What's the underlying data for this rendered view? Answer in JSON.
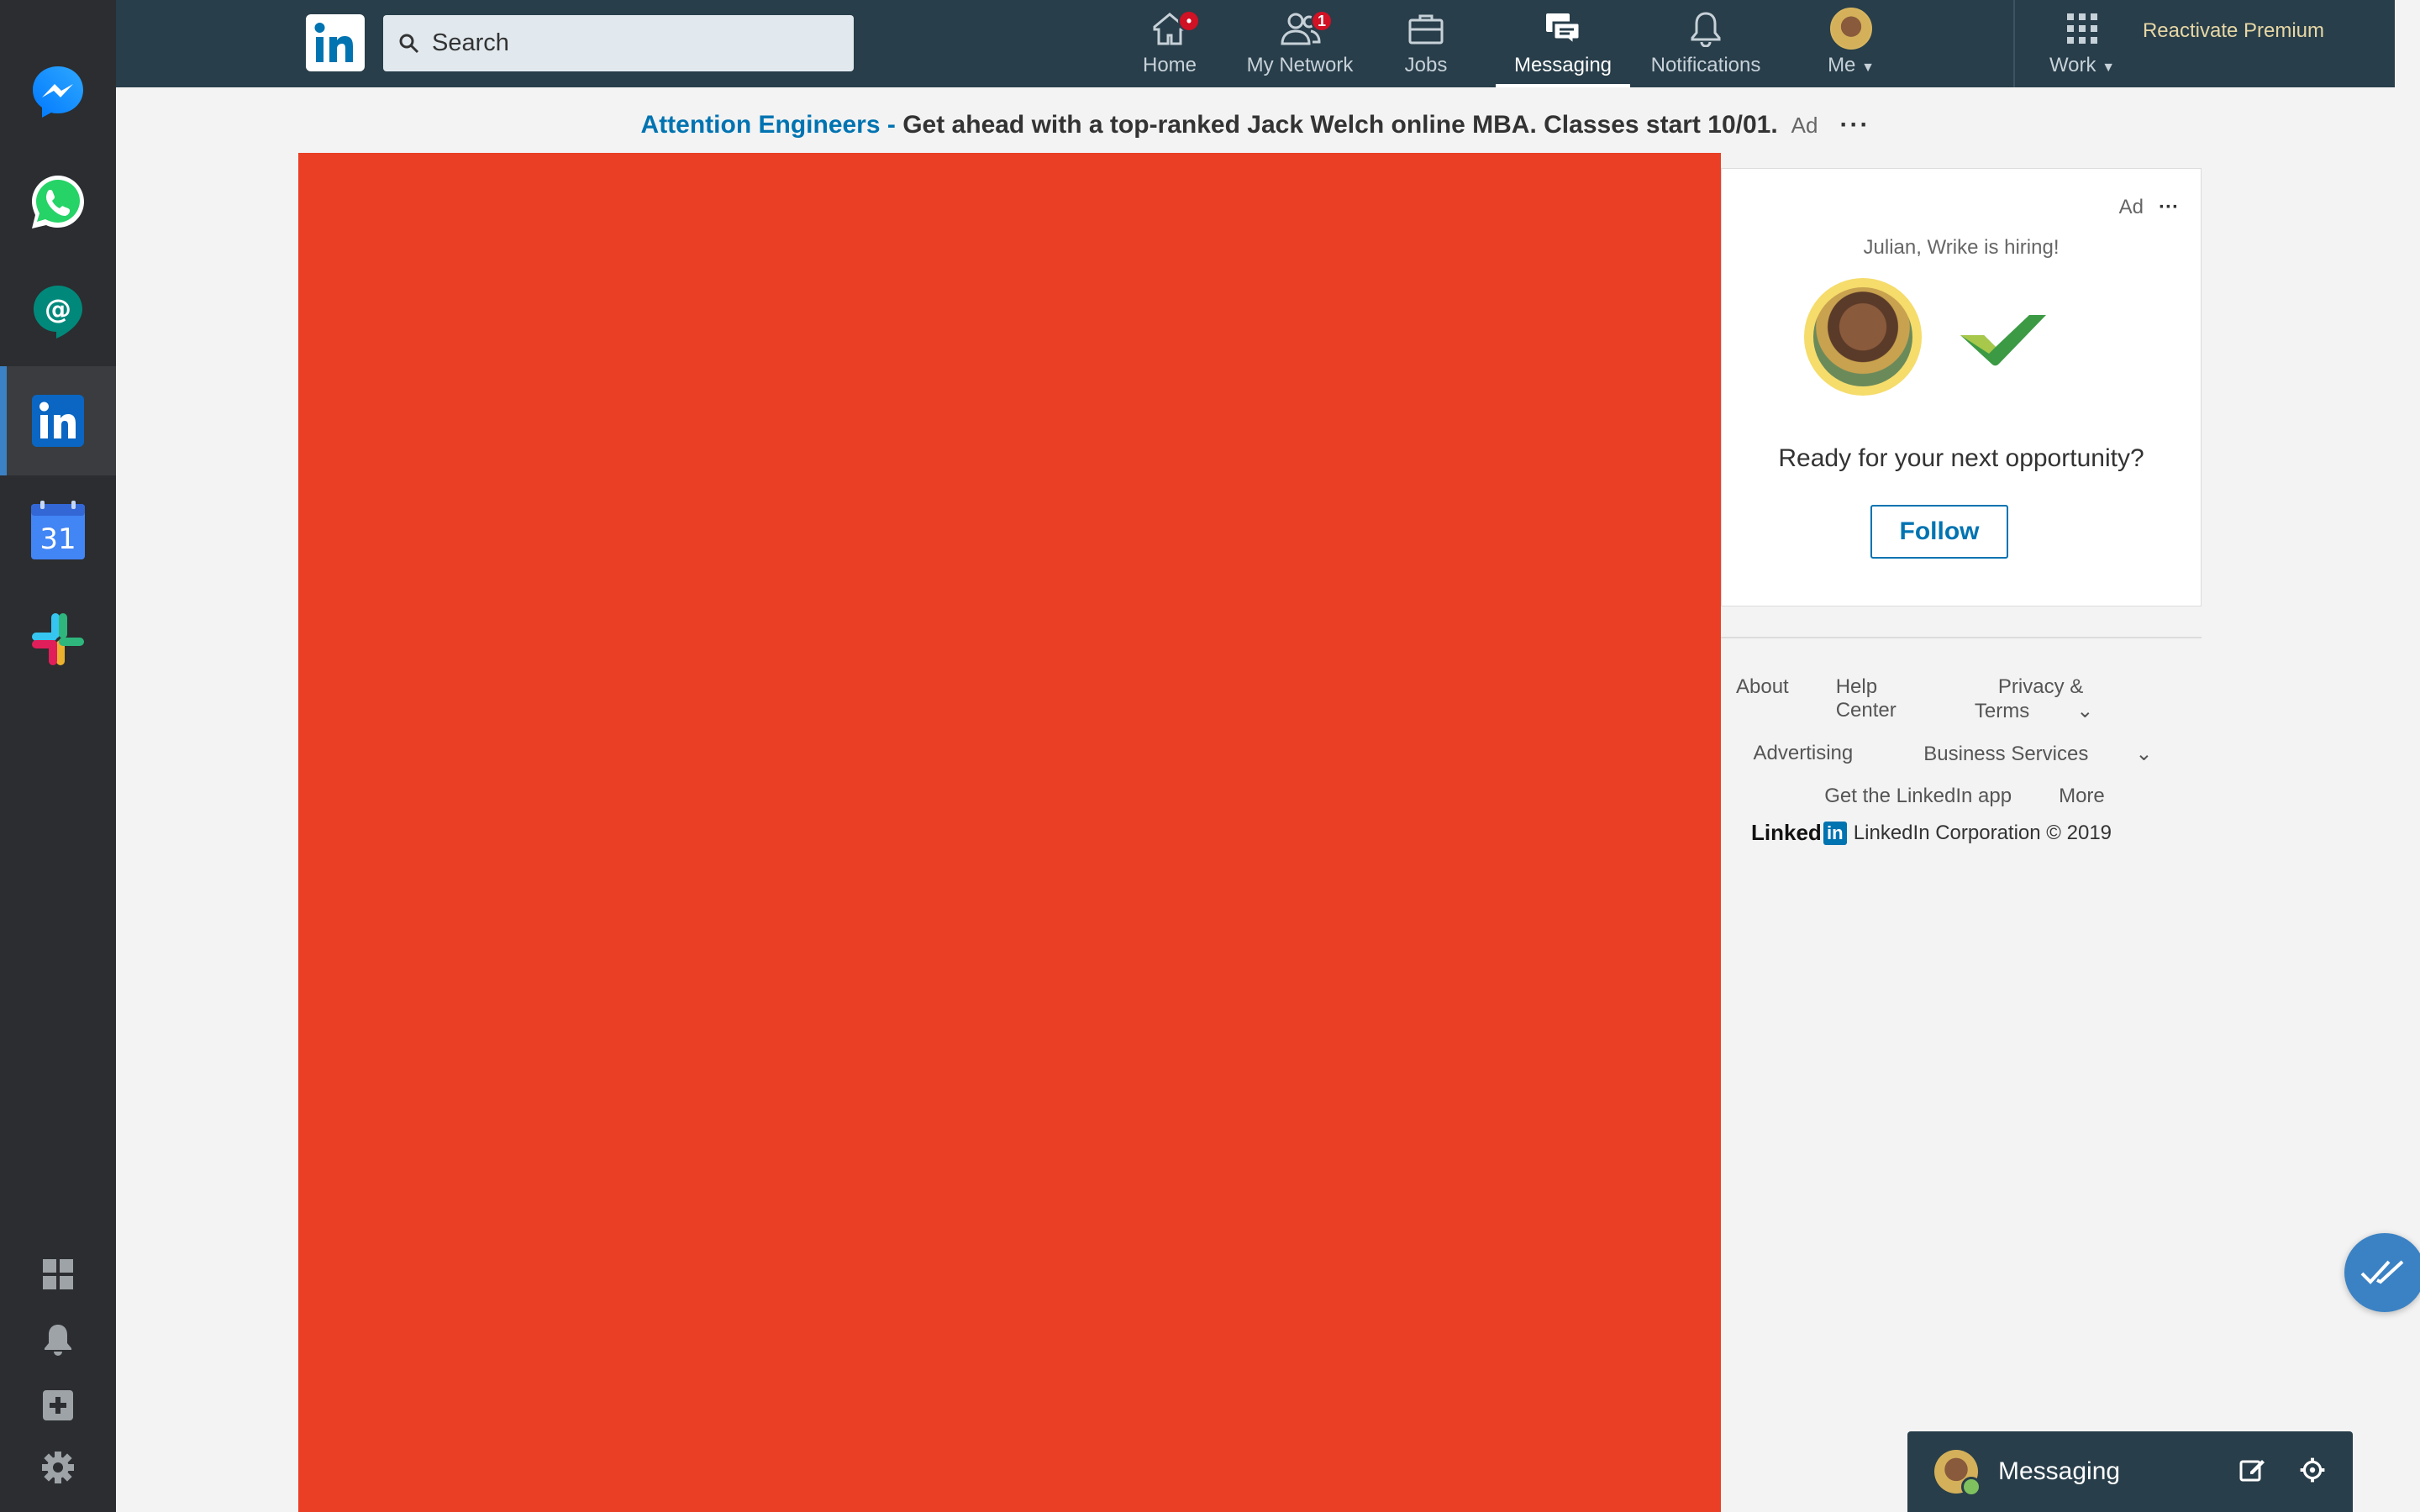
{
  "dock": {
    "apps": [
      "messenger",
      "whatsapp",
      "hangouts-chat",
      "linkedin",
      "google-calendar",
      "slack"
    ],
    "calendar_day": "31",
    "tools": [
      "grid-icon",
      "bell-icon",
      "add-icon",
      "gear-icon"
    ]
  },
  "nav": {
    "search_placeholder": "Search",
    "items": [
      {
        "label": "Home",
        "badge": "•"
      },
      {
        "label": "My Network",
        "badge": "1"
      },
      {
        "label": "Jobs"
      },
      {
        "label": "Messaging"
      },
      {
        "label": "Notifications"
      },
      {
        "label": "Me"
      },
      {
        "label": "Work"
      }
    ],
    "premium": "Reactivate Premium",
    "active": "Messaging"
  },
  "banner": {
    "highlight": "Attention Engineers -",
    "text": " Get ahead with a top-ranked Jack Welch online MBA. Classes start 10/01.",
    "ad_label": "Ad",
    "more": "···"
  },
  "side_ad": {
    "ad_label": "Ad",
    "more": "···",
    "hiring": "Julian, Wrike is hiring!",
    "headline": "Ready for your next opportunity?",
    "follow": "Follow"
  },
  "footer": {
    "links": [
      "About",
      "Help Center",
      "Privacy & Terms",
      "Advertising",
      "Business Services",
      "Get the LinkedIn app",
      "More"
    ],
    "brand": "Linked",
    "brand_box": "in",
    "copyright": "LinkedIn Corporation © 2019"
  },
  "messaging_bar": {
    "label": "Messaging"
  },
  "colors": {
    "nav_bg": "#283e4a",
    "accent": "#0073b1",
    "red_block": "#ea3f25",
    "dock_bg": "#2b2d30"
  }
}
